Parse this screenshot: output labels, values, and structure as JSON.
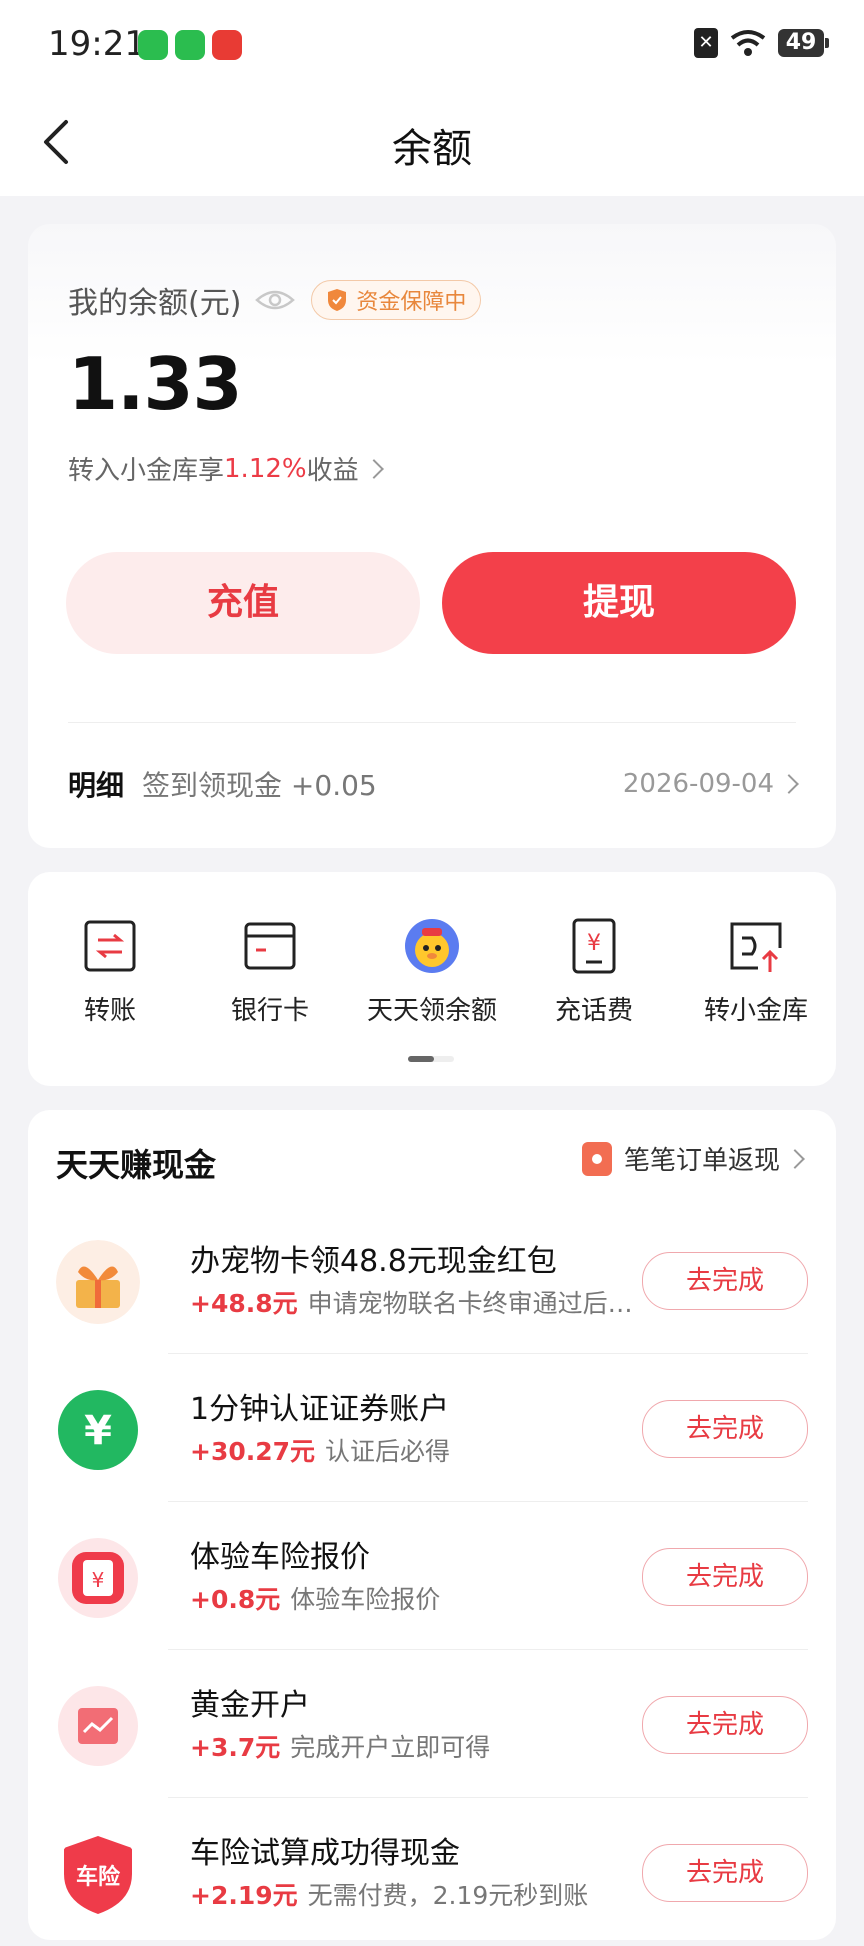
{
  "status_bar": {
    "time": "19:21",
    "battery": "49"
  },
  "header": {
    "title": "余额"
  },
  "balance": {
    "label": "我的余额(元)",
    "guarantee": "资金保障中",
    "amount": "1.33",
    "promo_prefix": "转入小金库享",
    "promo_rate": "1.12%",
    "promo_suffix": "收益",
    "recharge_label": "充值",
    "withdraw_label": "提现",
    "detail_label": "明细",
    "detail_desc": "签到领现金 +0.05",
    "detail_date": "2026-09-04"
  },
  "actions": [
    {
      "label": "转账",
      "icon": "transfer-icon"
    },
    {
      "label": "银行卡",
      "icon": "bank-card-icon"
    },
    {
      "label": "天天领余额",
      "icon": "mascot-icon"
    },
    {
      "label": "充话费",
      "icon": "phone-recharge-icon"
    },
    {
      "label": "转小金库",
      "icon": "vault-transfer-icon"
    }
  ],
  "tasks": {
    "title": "天天赚现金",
    "link": "笔笔订单返现",
    "button_label": "去完成",
    "items": [
      {
        "title": "办宠物卡领48.8元现金红包",
        "reward": "+48.8元",
        "desc": "申请宠物联名卡终审通过后可得",
        "icon": "gift-icon"
      },
      {
        "title": "1分钟认证证券账户",
        "reward": "+30.27元",
        "desc": "认证后必得",
        "icon": "yuan-coin-icon"
      },
      {
        "title": "体验车险报价",
        "reward": "+0.8元",
        "desc": "体验车险报价",
        "icon": "insurance-quote-icon"
      },
      {
        "title": "黄金开户",
        "reward": "+3.7元",
        "desc": "完成开户立即可得",
        "icon": "gold-account-icon"
      },
      {
        "title": "车险试算成功得现金",
        "reward": "+2.19元",
        "desc": "无需付费，2.19元秒到账",
        "icon": "car-insurance-icon",
        "icon_text": "车险"
      }
    ]
  }
}
